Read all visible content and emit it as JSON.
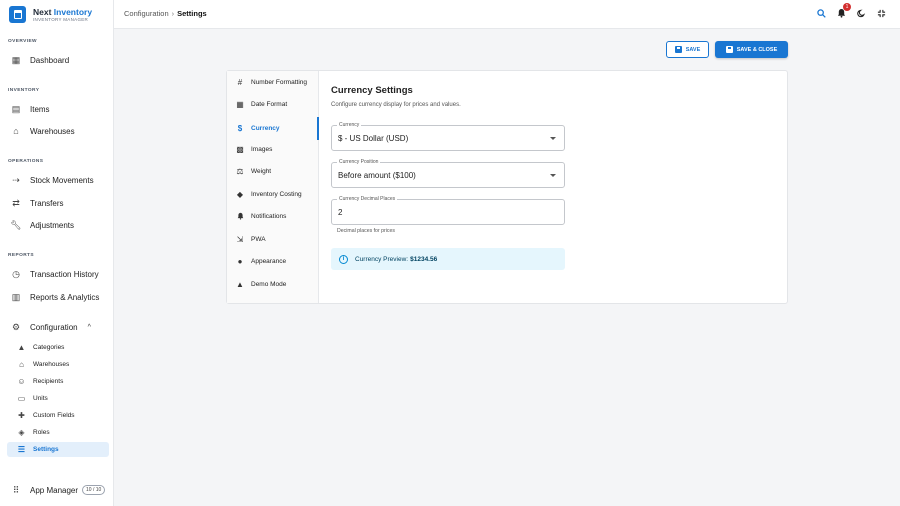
{
  "brand": {
    "name_part1": "Next ",
    "name_part2": "Inventory",
    "subtitle": "INVENTORY MANAGER"
  },
  "sidebar": {
    "overview_title": "OVERVIEW",
    "dashboard": "Dashboard",
    "inventory_title": "INVENTORY",
    "items": "Items",
    "warehouses": "Warehouses",
    "operations_title": "OPERATIONS",
    "stock_movements": "Stock Movements",
    "transfers": "Transfers",
    "adjustments": "Adjustments",
    "reports_title": "REPORTS",
    "transaction_history": "Transaction History",
    "reports_analytics": "Reports & Analytics",
    "configuration": "Configuration",
    "config_items": [
      "Categories",
      "Warehouses",
      "Recipients",
      "Units",
      "Custom Fields",
      "Roles",
      "Settings"
    ],
    "app_manager": "App Manager",
    "app_manager_count": "10 / 10"
  },
  "topbar": {
    "breadcrumb_parent": "Configuration",
    "breadcrumb_sep": "›",
    "breadcrumb_current": "Settings",
    "notification_count": "1"
  },
  "actions": {
    "save": "SAVE",
    "save_close": "SAVE & CLOSE"
  },
  "settings_nav": [
    "Number Formatting",
    "Date Format",
    "Currency",
    "Images",
    "Weight",
    "Inventory Costing",
    "Notifications",
    "PWA",
    "Appearance",
    "Demo Mode"
  ],
  "currency": {
    "title": "Currency Settings",
    "description": "Configure currency display for prices and values.",
    "currency_label": "Currency",
    "currency_value": "$ - US Dollar (USD)",
    "position_label": "Currency Position",
    "position_value": "Before amount ($100)",
    "decimals_label": "Currency Decimal Places",
    "decimals_value": "2",
    "decimals_helper": "Decimal places for prices",
    "preview_label": "Currency Preview:",
    "preview_value": "$1234.56"
  },
  "colors": {
    "accent": "#1976d2",
    "active_bg": "#e3effb",
    "info_bg": "#e5f6fd",
    "badge": "#d32f2f"
  }
}
